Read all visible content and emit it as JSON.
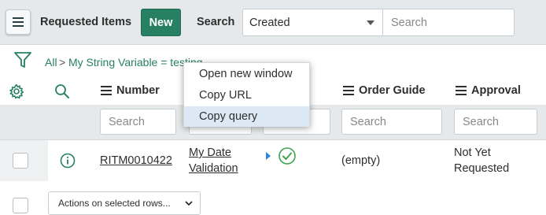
{
  "header": {
    "title": "Requested Items",
    "new_label": "New",
    "search_label": "Search",
    "field_select": "Created",
    "search_placeholder": "Search"
  },
  "filter": {
    "all": "All",
    "separator": ">",
    "condition": "My String Variable = testing"
  },
  "columns": {
    "number": "Number",
    "order_guide": "Order Guide",
    "approval": "Approval",
    "search_placeholder": "Search"
  },
  "row": {
    "number": "RITM0010422",
    "item_line1": "My Date",
    "item_line2": "Validation",
    "order_guide": "(empty)",
    "approval_line1": "Not Yet",
    "approval_line2": "Requested"
  },
  "actions": {
    "label": "Actions on selected rows..."
  },
  "context_menu": {
    "items": [
      "Open new window",
      "Copy URL",
      "Copy query"
    ]
  },
  "colors": {
    "accent": "#278062",
    "highlight": "#dde8f5"
  },
  "icons": [
    "hamburger-menu-icon",
    "filter-funnel-icon",
    "gear-icon",
    "search-icon",
    "info-icon",
    "play-arrow-icon",
    "check-circle-icon",
    "chevron-down-icon"
  ]
}
